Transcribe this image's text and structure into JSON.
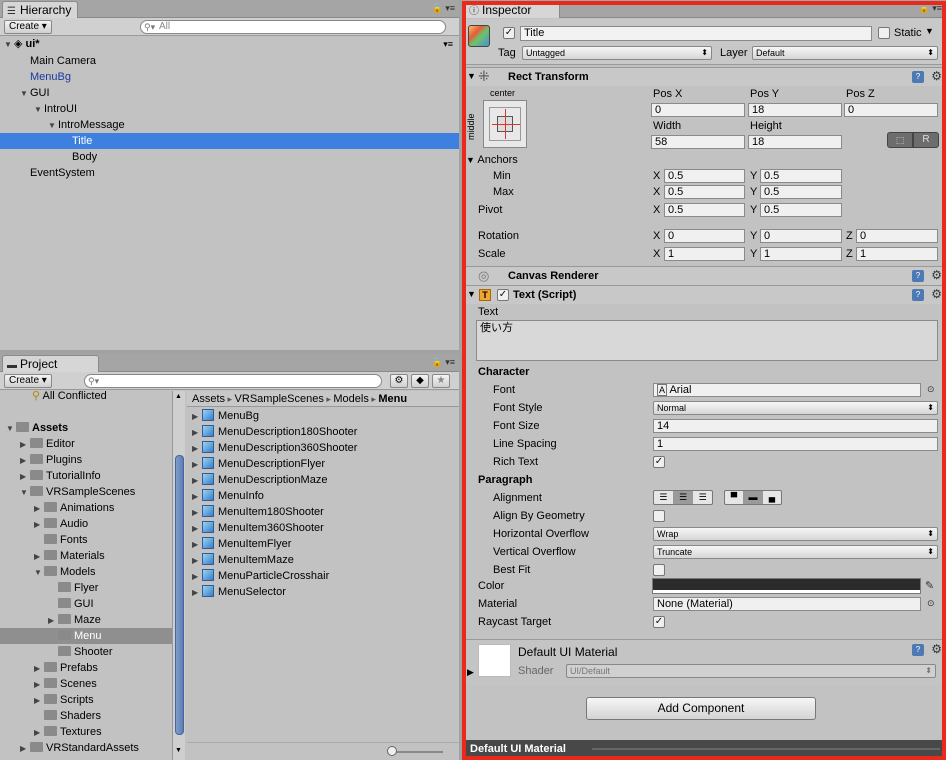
{
  "hierarchy": {
    "tab": "Hierarchy",
    "create": "Create",
    "search_placeholder": "All",
    "scene": "ui*",
    "items": [
      {
        "label": "Main Camera",
        "indent": 0,
        "arrow": ""
      },
      {
        "label": "MenuBg",
        "indent": 0,
        "arrow": "",
        "color": "#1a3aa0"
      },
      {
        "label": "GUI",
        "indent": 0,
        "arrow": "▼"
      },
      {
        "label": "IntroUI",
        "indent": 1,
        "arrow": "▼"
      },
      {
        "label": "IntroMessage",
        "indent": 2,
        "arrow": "▼"
      },
      {
        "label": "Title",
        "indent": 3,
        "arrow": "",
        "selected": true
      },
      {
        "label": "Body",
        "indent": 3,
        "arrow": ""
      },
      {
        "label": "EventSystem",
        "indent": 0,
        "arrow": ""
      }
    ]
  },
  "project": {
    "tab": "Project",
    "create": "Create",
    "all_conflicted": "All Conflicted",
    "tree": [
      {
        "label": "Assets",
        "indent": 0,
        "arrow": "▼",
        "bold": true
      },
      {
        "label": "Editor",
        "indent": 1,
        "arrow": "▶"
      },
      {
        "label": "Plugins",
        "indent": 1,
        "arrow": "▶"
      },
      {
        "label": "TutorialInfo",
        "indent": 1,
        "arrow": "▶"
      },
      {
        "label": "VRSampleScenes",
        "indent": 1,
        "arrow": "▼"
      },
      {
        "label": "Animations",
        "indent": 2,
        "arrow": "▶"
      },
      {
        "label": "Audio",
        "indent": 2,
        "arrow": "▶"
      },
      {
        "label": "Fonts",
        "indent": 2,
        "arrow": ""
      },
      {
        "label": "Materials",
        "indent": 2,
        "arrow": "▶"
      },
      {
        "label": "Models",
        "indent": 2,
        "arrow": "▼"
      },
      {
        "label": "Flyer",
        "indent": 3,
        "arrow": ""
      },
      {
        "label": "GUI",
        "indent": 3,
        "arrow": ""
      },
      {
        "label": "Maze",
        "indent": 3,
        "arrow": "▶"
      },
      {
        "label": "Menu",
        "indent": 3,
        "arrow": "",
        "selected": true
      },
      {
        "label": "Shooter",
        "indent": 3,
        "arrow": ""
      },
      {
        "label": "Prefabs",
        "indent": 2,
        "arrow": "▶"
      },
      {
        "label": "Scenes",
        "indent": 2,
        "arrow": "▶"
      },
      {
        "label": "Scripts",
        "indent": 2,
        "arrow": "▶"
      },
      {
        "label": "Shaders",
        "indent": 2,
        "arrow": ""
      },
      {
        "label": "Textures",
        "indent": 2,
        "arrow": "▶"
      },
      {
        "label": "VRStandardAssets",
        "indent": 1,
        "arrow": "▶"
      }
    ],
    "breadcrumb": [
      "Assets",
      "VRSampleScenes",
      "Models",
      "Menu"
    ],
    "assets": [
      "MenuBg",
      "MenuDescription180Shooter",
      "MenuDescription360Shooter",
      "MenuDescriptionFlyer",
      "MenuDescriptionMaze",
      "MenuInfo",
      "MenuItem180Shooter",
      "MenuItem360Shooter",
      "MenuItemFlyer",
      "MenuItemMaze",
      "MenuParticleCrosshair",
      "MenuSelector"
    ]
  },
  "inspector": {
    "tab": "Inspector",
    "object_name": "Title",
    "static_label": "Static",
    "tag_label": "Tag",
    "tag_value": "Untagged",
    "layer_label": "Layer",
    "layer_value": "Default",
    "rect_transform": {
      "title": "Rect Transform",
      "anchor_h": "center",
      "anchor_v": "middle",
      "pos_x_label": "Pos X",
      "pos_y_label": "Pos Y",
      "pos_z_label": "Pos Z",
      "pos_x": "0",
      "pos_y": "18",
      "pos_z": "0",
      "width_label": "Width",
      "height_label": "Height",
      "width": "58",
      "height": "18",
      "r_btn": "R",
      "anchors": "Anchors",
      "min": "Min",
      "max": "Max",
      "min_x": "0.5",
      "min_y": "0.5",
      "max_x": "0.5",
      "max_y": "0.5",
      "pivot": "Pivot",
      "pivot_x": "0.5",
      "pivot_y": "0.5",
      "rotation": "Rotation",
      "rot_x": "0",
      "rot_y": "0",
      "rot_z": "0",
      "scale": "Scale",
      "scale_x": "1",
      "scale_y": "1",
      "scale_z": "1",
      "x": "X",
      "y": "Y",
      "z": "Z"
    },
    "canvas_renderer": "Canvas Renderer",
    "text_script": {
      "title": "Text (Script)",
      "text_label": "Text",
      "text_value": "使い方",
      "character": "Character",
      "font_label": "Font",
      "font_value": "Arial",
      "font_style_label": "Font Style",
      "font_style_value": "Normal",
      "font_size_label": "Font Size",
      "font_size_value": "14",
      "line_spacing_label": "Line Spacing",
      "line_spacing_value": "1",
      "rich_text_label": "Rich Text",
      "paragraph": "Paragraph",
      "alignment_label": "Alignment",
      "align_geom_label": "Align By Geometry",
      "h_overflow_label": "Horizontal Overflow",
      "h_overflow_value": "Wrap",
      "v_overflow_label": "Vertical Overflow",
      "v_overflow_value": "Truncate",
      "best_fit_label": "Best Fit",
      "color_label": "Color",
      "color_value": "#2b2b2b",
      "material_label": "Material",
      "material_value": "None (Material)",
      "raycast_label": "Raycast Target"
    },
    "material": {
      "name": "Default UI Material",
      "shader_label": "Shader",
      "shader_value": "UI/Default"
    },
    "add_component": "Add Component",
    "preview_label": "Default UI Material"
  },
  "highlight_color": "#e8291b"
}
